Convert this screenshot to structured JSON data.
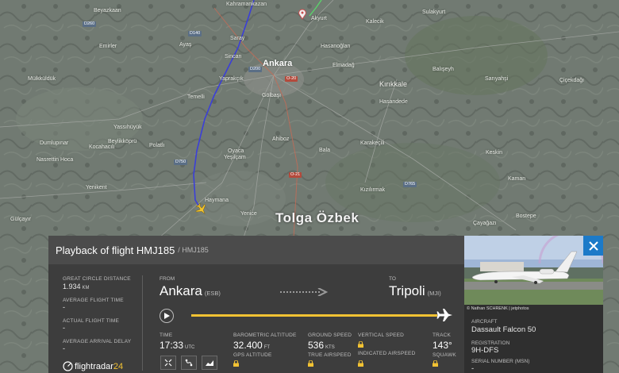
{
  "map": {
    "watermark": "Tolga Özbek",
    "labels_big": [
      "Ankara",
      "Kırıkkale"
    ],
    "labels": [
      "Kahramankazan",
      "Beyazkaan",
      "Saray",
      "Sincan",
      "Yaprakçık",
      "Temelli",
      "Gölbaşı",
      "Ahiboz",
      "Oyaca",
      "Yeşilçam",
      "Haymana",
      "Yenice",
      "Elmadağ",
      "Hasanoğlan",
      "Hasandede",
      "Bala",
      "Karakeçili",
      "Keskin",
      "Kızılırmak",
      "Akyurt",
      "Kalecik",
      "Sulakyurt",
      "Balışeyh",
      "Sarıyahşi",
      "Çiçekdağı",
      "Yenikent",
      "Gülçayır",
      "Yassıhüyük",
      "Beylikköprü",
      "Polatlı",
      "Kocahacılı",
      "Mülkküldük",
      "Emirler",
      "Temelli",
      "Ayaş",
      "Dumlupınar",
      "Nasrettin Hoca",
      "Çayağazı",
      "Bostepe",
      "Kaman"
    ],
    "roads": [
      "D140",
      "D200",
      "D750",
      "O-20",
      "D765",
      "D260",
      "O-21"
    ]
  },
  "panel": {
    "title": "Playback of flight HMJ185",
    "subtitle": "/ HMJ185",
    "stats": [
      {
        "label": "GREAT CIRCLE DISTANCE",
        "value": "1.934",
        "unit": "KM"
      },
      {
        "label": "AVERAGE FLIGHT TIME",
        "value": "-"
      },
      {
        "label": "ACTUAL FLIGHT TIME",
        "value": "-"
      },
      {
        "label": "AVERAGE ARRIVAL DELAY",
        "value": "-"
      }
    ],
    "brand": "flightradar24",
    "from_label": "FROM",
    "from_city": "Ankara",
    "from_code": "(ESB)",
    "to_label": "TO",
    "to_city": "Tripoli",
    "to_code": "(MJI)",
    "progress": 1.0,
    "time_label": "TIME",
    "time_value": "17:33",
    "time_unit": "UTC",
    "baro_label": "BAROMETRIC ALTITUDE",
    "baro_value": "32.400",
    "baro_unit": "FT",
    "gps_label": "GPS ALTITUDE",
    "gs_label": "GROUND SPEED",
    "gs_value": "536",
    "gs_unit": "KTS",
    "tas_label": "TRUE AIRSPEED",
    "vs_label": "VERTICAL SPEED",
    "ias_label": "INDICATED AIRSPEED",
    "track_label": "TRACK",
    "track_value": "143°",
    "squawk_label": "SQUAWK"
  },
  "aircraft": {
    "photo_credit": "© Nathan SCHRENK | jetphotos",
    "aircraft_label": "AIRCRAFT",
    "aircraft_value": "Dassault Falcon 50",
    "reg_label": "REGISTRATION",
    "reg_value": "9H-DFS",
    "msn_label": "SERIAL NUMBER (MSN)",
    "msn_value": "-"
  },
  "colors": {
    "track_line": "#3b3fd8",
    "progress": "#f2c233",
    "close_button": "#1c7ac8"
  }
}
